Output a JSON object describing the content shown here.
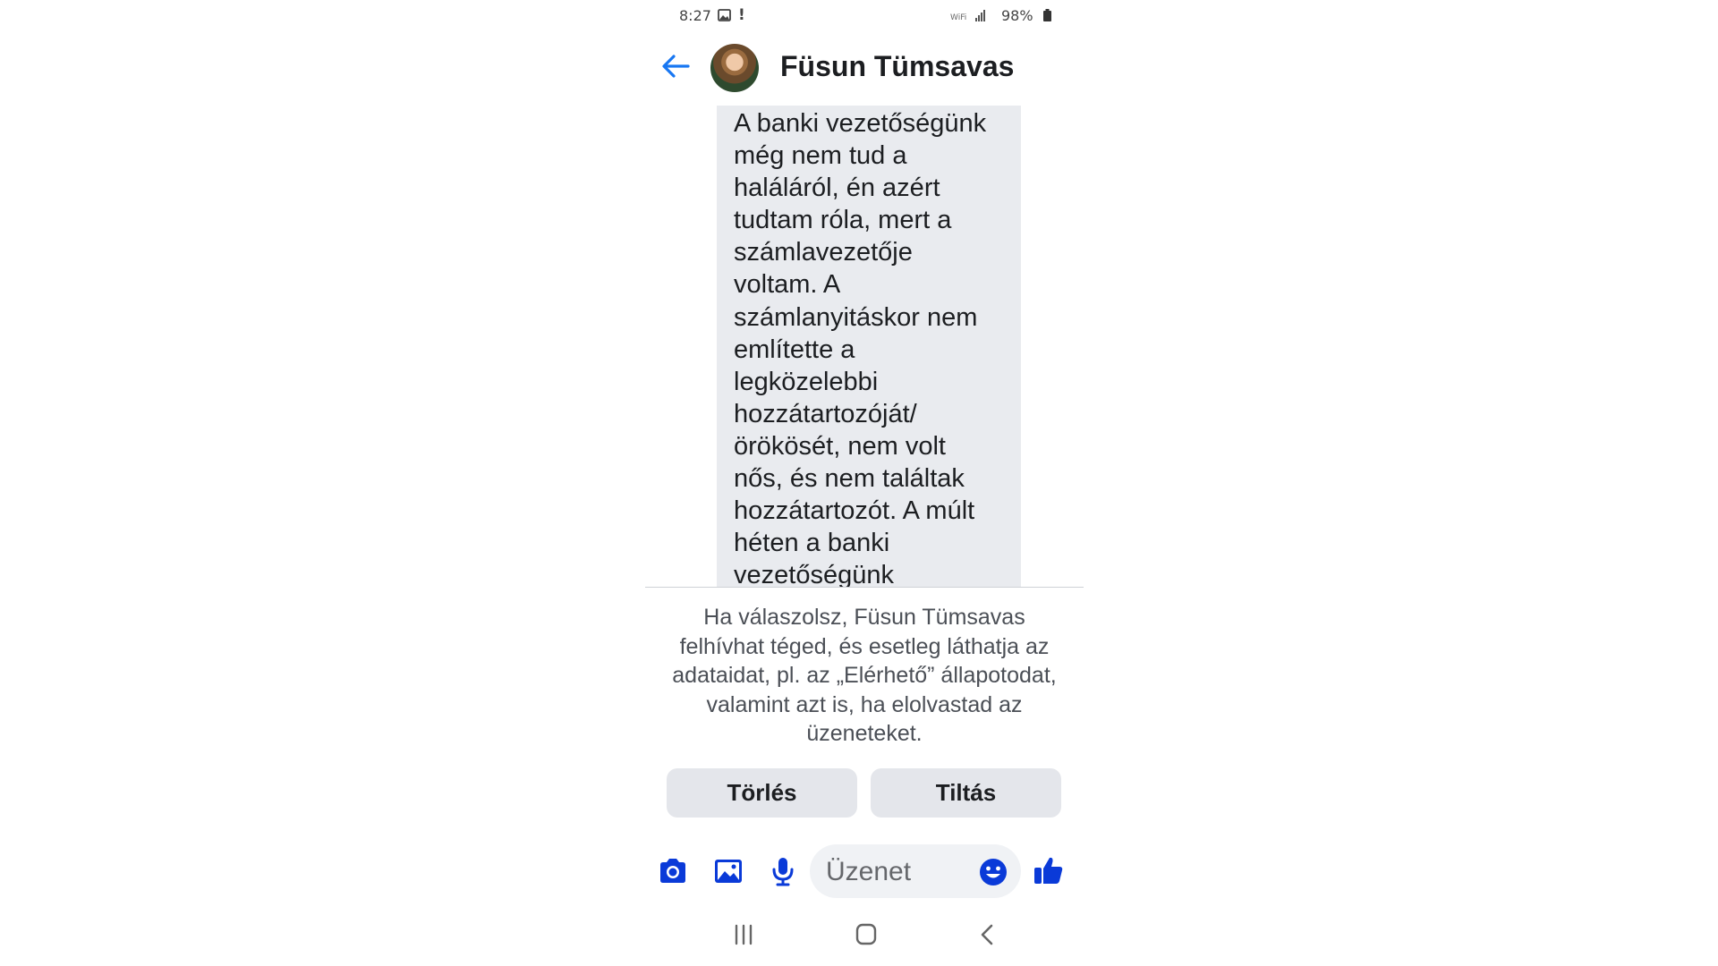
{
  "status_bar": {
    "time": "8:27",
    "alert": "!",
    "battery": "98%"
  },
  "header": {
    "contact_name": "Füsun Tümsavas"
  },
  "message": {
    "text": "A banki vezetőségünk\nmég nem tud a\nhaláláról, én azért\ntudtam róla, mert a\nszámlavezetője\nvoltam. A\nszámlanyitáskor nem\nemlítette a\nlegközelebbi\nhozzátartozóját/\nörökösét, nem volt\nnős, és nem találtak\nhozzátartozót. A múlt\nhéten a banki\nvezetőségünk"
  },
  "notice": {
    "text": "Ha válaszolsz, Füsun Tümsavas felhívhat téged, és esetleg láthatja az adataidat, pl. az „Elérhető” állapotodat, valamint azt is, ha elolvastad az üzeneteket."
  },
  "actions": {
    "delete_label": "Törlés",
    "block_label": "Tiltás"
  },
  "composer": {
    "placeholder": "Üzenet",
    "value": ""
  },
  "icons": {
    "accent": "#1877f2",
    "composer_icon_color": "#0a3ad8",
    "back": "back-arrow-icon",
    "camera": "camera-icon",
    "gallery": "image-icon",
    "microphone": "microphone-icon",
    "emoji": "emoji-icon",
    "like": "thumbs-up-icon"
  }
}
